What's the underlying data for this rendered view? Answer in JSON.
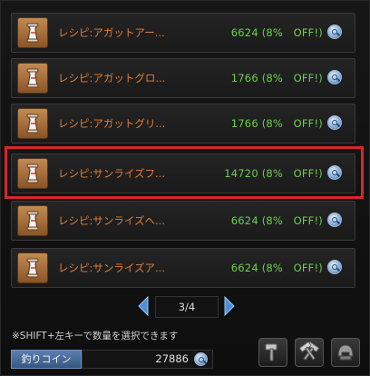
{
  "items": [
    {
      "name": "レシピ:アガットアー...",
      "price": "6624 (8%",
      "discount": "OFF!)"
    },
    {
      "name": "レシピ:アガットグロ...",
      "price": "1766 (8%",
      "discount": "OFF!)"
    },
    {
      "name": "レシピ:アガットグリ...",
      "price": "1766 (8%",
      "discount": "OFF!)"
    },
    {
      "name": "レシピ:サンライズフ...",
      "price": "14720 (8%",
      "discount": "OFF!)"
    },
    {
      "name": "レシピ:サンライズヘ...",
      "price": "6624 (8%",
      "discount": "OFF!)"
    },
    {
      "name": "レシピ:サンライズア...",
      "price": "6624 (8%",
      "discount": "OFF!)"
    }
  ],
  "selected_index": 3,
  "pagination": {
    "label": "3/4"
  },
  "hint": "※SHIFT+左キーで数量を選択できます",
  "currency": {
    "label": "釣りコイン",
    "value": "27886"
  },
  "icons": {
    "item": "recipe-scroll-icon",
    "price_currency": "coin-icon",
    "tools": [
      "hammer-icon",
      "crossed-hammers-icon",
      "helmet-icon"
    ]
  },
  "colors": {
    "item_name": "#e07f36",
    "price": "#6bcf4e",
    "selection": "#d7262a",
    "currency_label_bg": "#4a6d9c"
  }
}
